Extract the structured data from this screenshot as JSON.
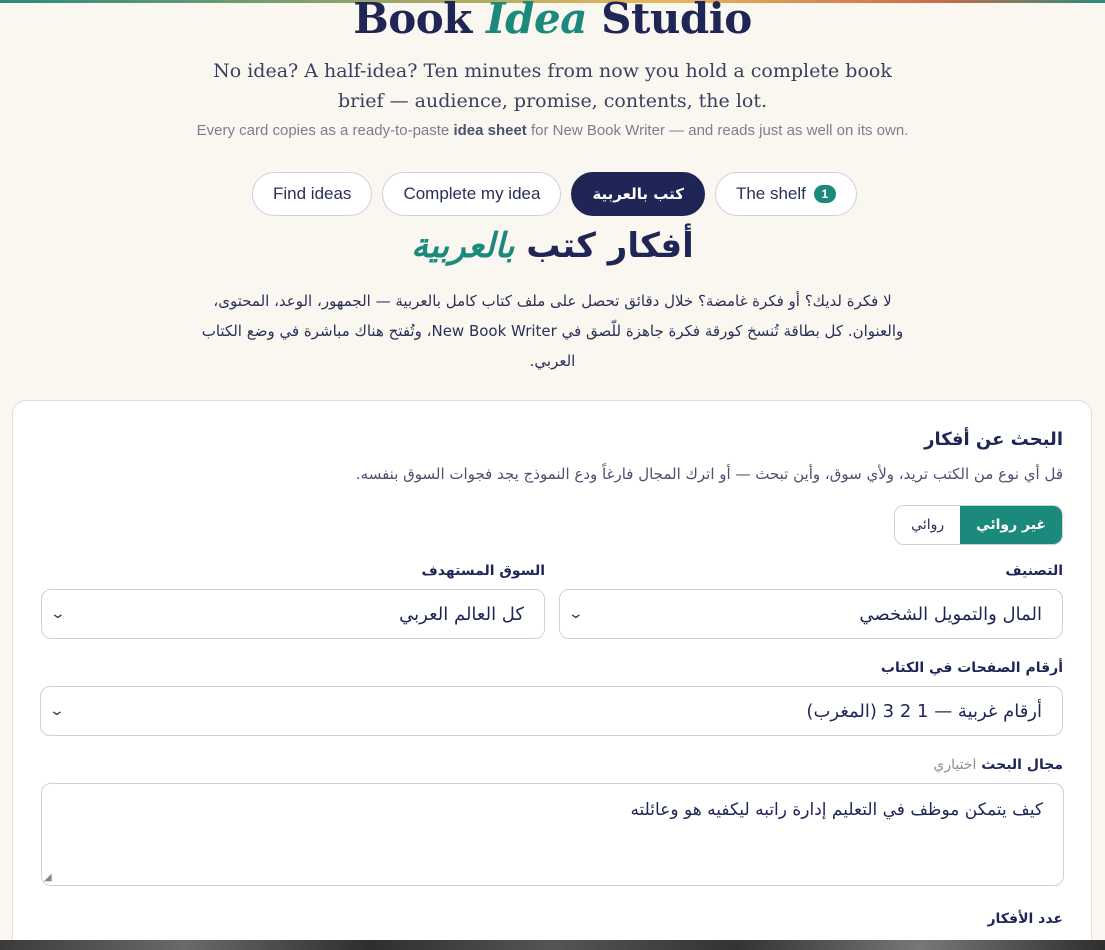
{
  "header": {
    "title_part1": "Book ",
    "title_accent": "Idea",
    "title_part2": " Studio",
    "subtitle": "No idea? A half-idea? Ten minutes from now you hold a complete book brief — audience, promise, contents, the lot.",
    "note_prefix": "Every card copies as a ready-to-paste ",
    "note_bold": "idea sheet",
    "note_suffix": " for New Book Writer — and reads just as well on its own."
  },
  "tabs": [
    {
      "label": "Find ideas",
      "active": false
    },
    {
      "label": "Complete my idea",
      "active": false
    },
    {
      "label": "كتب بالعربية",
      "active": true
    },
    {
      "label": "The shelf",
      "badge": "1",
      "active": false
    }
  ],
  "arabic": {
    "title_plain": "أفكار كتب ",
    "title_accent": "بالعربية",
    "intro": "لا فكرة لديك؟ أو فكرة غامضة؟ خلال دقائق تحصل على ملف كتاب كامل بالعربية — الجمهور، الوعد، المحتوى، والعنوان. كل بطاقة تُنسخ كورقة فكرة جاهزة للّصق في New Book Writer، وتُفتح هناك مباشرة في وضع الكتاب العربي."
  },
  "form": {
    "heading": "البحث عن أفكار",
    "description": "قل أي نوع من الكتب تريد، ولأي سوق، وأين تبحث — أو اترك المجال فارغاً ودع النموذج يجد فجوات السوق بنفسه.",
    "segment": {
      "nonfiction": "غير روائي",
      "fiction": "روائي",
      "selected": "nonfiction"
    },
    "category_label": "التصنيف",
    "category_value": "المال والتمويل الشخصي",
    "market_label": "السوق المستهدف",
    "market_value": "كل العالم العربي",
    "numerals_label": "أرقام الصفحات في الكتاب",
    "numerals_value": "أرقام غربية — 1 2 3 (المغرب)",
    "field_label": "مجال البحث",
    "field_optional": "اختياري",
    "field_value": "كيف يتمكن موظف في التعليم إدارة راتبه ليكفيه هو وعائلته",
    "count_label": "عدد الأفكار"
  },
  "colors": {
    "navy": "#1f2656",
    "teal": "#1b8a7c",
    "background": "#faf7f0"
  }
}
